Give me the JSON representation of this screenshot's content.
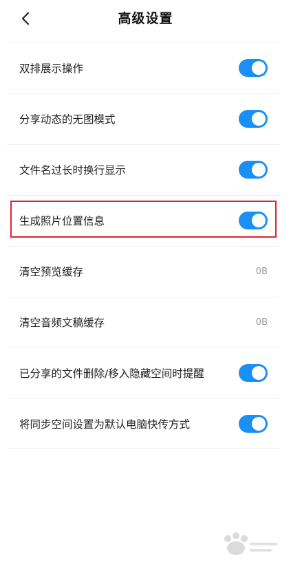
{
  "header": {
    "title": "高级设置",
    "back_icon": "chevron-left-icon"
  },
  "accent_color": "#1a8ff5",
  "highlight_color": "#e0232b",
  "settings": [
    {
      "label": "双排展示操作",
      "type": "toggle",
      "on": true
    },
    {
      "label": "分享动态的无图模式",
      "type": "toggle",
      "on": true
    },
    {
      "label": "文件名过长时换行显示",
      "type": "toggle",
      "on": true
    },
    {
      "label": "生成照片位置信息",
      "type": "toggle",
      "on": true,
      "highlighted": true
    },
    {
      "label": "清空预览缓存",
      "type": "value",
      "value": "0B"
    },
    {
      "label": "清空音频文稿缓存",
      "type": "value",
      "value": "0B"
    },
    {
      "label": "已分享的文件删除/移入隐藏空间时提醒",
      "type": "toggle",
      "on": true
    },
    {
      "label": "将同步空间设置为默认电脑快传方式",
      "type": "toggle",
      "on": true
    }
  ]
}
